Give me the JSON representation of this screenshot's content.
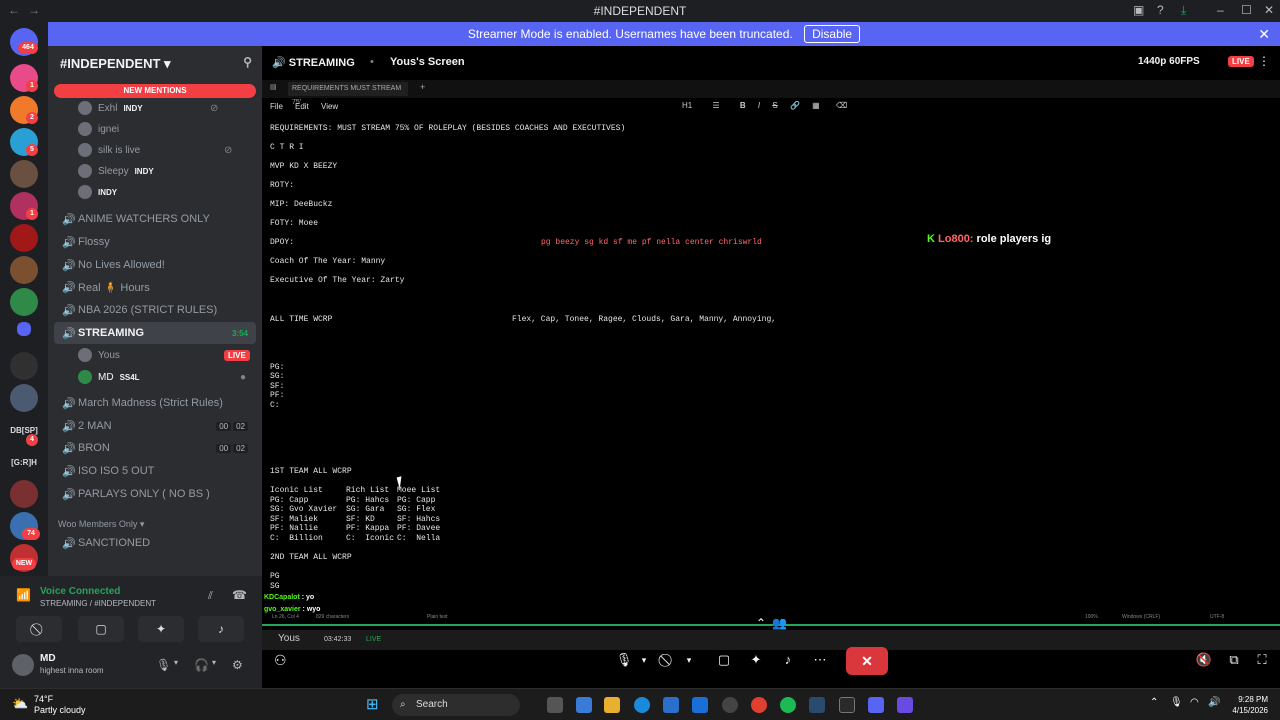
{
  "window": {
    "title": "#INDEPENDENT"
  },
  "banner": {
    "text": "Streamer Mode is enabled. Usernames have been truncated.",
    "disable_label": "Disable"
  },
  "servers": {
    "dm_badge": "464",
    "badges": [
      "1",
      "2",
      "5",
      "1",
      "1",
      "4",
      "74"
    ],
    "text_labels": [
      "DB[SP]",
      "[G:R]H"
    ],
    "new_label": "NEW"
  },
  "server": {
    "name": "#INDEPENDENT",
    "new_mentions": "NEW MENTIONS"
  },
  "voice_users_top": [
    {
      "name": "Exhl",
      "tag": "INDY"
    },
    {
      "name": "ignei",
      "tag": ""
    },
    {
      "name": "silk is live",
      "tag": ""
    },
    {
      "name": "Sleepy",
      "tag": "INDY"
    },
    {
      "name": "",
      "tag": "INDY"
    }
  ],
  "channels": [
    {
      "name": "ANIME WATCHERS ONLY"
    },
    {
      "name": "Flossy"
    },
    {
      "name": "No Lives Allowed!"
    },
    {
      "name": "Real 🧍 Hours"
    },
    {
      "name": "NBA 2026 (STRICT RULES)"
    },
    {
      "name": "STREAMING",
      "time": "3:54"
    }
  ],
  "streaming_users": [
    {
      "name": "Yous",
      "live": "LIVE"
    },
    {
      "name": "MD",
      "tag": "SS4L"
    }
  ],
  "channels2": [
    {
      "name": "March Madness (Strict Rules)"
    },
    {
      "name": "2 MAN",
      "c1": "00",
      "c2": "02"
    },
    {
      "name": "BRON",
      "c1": "00",
      "c2": "02"
    },
    {
      "name": "ISO ISO 5 OUT"
    },
    {
      "name": "PARLAYS ONLY ( NO BS )"
    }
  ],
  "category": {
    "name": "Woo Members Only"
  },
  "channel_sanctioned": "SANCTIONED",
  "voice": {
    "status": "Voice Connected",
    "location": "STREAMING / #INDEPENDENT"
  },
  "user": {
    "name": "MD",
    "status": "highest inna room"
  },
  "stream": {
    "channel": "STREAMING",
    "screen": "Yous's Screen",
    "quality": "1440p 60FPS",
    "live": "LIVE"
  },
  "notepad": {
    "tab": "REQUIREMENTS MUST STREAM 75'",
    "menu": [
      "File",
      "Edit",
      "View"
    ],
    "toolbar_h": "H1",
    "lines": [
      "REQUIREMENTS: MUST STREAM 75% OF ROLEPLAY (BESIDES COACHES AND EXECUTIVES)",
      "C T R I",
      "MVP KD X BEEZY",
      "ROTY:",
      "MIP: DeeBuckz",
      "FOTY: Moee",
      "DPOY:",
      "Coach Of The Year: Manny",
      "Executive Of The Year: Zarty",
      "ALL TIME WCRP",
      "PG:",
      "SG:",
      "SF:",
      "PF:",
      "C:",
      "1ST TEAM ALL WCRP",
      "Iconic List",
      "PG: Capp",
      "SG: Gvo Xavier",
      "SF: Maliek",
      "PF: Nallie",
      "C:  Billion",
      "2ND TEAM ALL WCRP",
      "PG",
      "SG"
    ],
    "col2": [
      "Rich List",
      "PG: Hahcs",
      "SG: Gara",
      "SF: KD",
      "PF: Kappa",
      "C:  Iconic"
    ],
    "col3": [
      "Moee List",
      "PG: Capp",
      "SG: Flex",
      "SF: Hahcs",
      "PF: Davee",
      "C:  Nella"
    ],
    "dpoy_note": "pg beezy sg kd sf me pf nella center chriswrld",
    "wcrp_names": "Flex, Cap, Tonee, Ragee, Clouds, Gara, Manny, Annoying,",
    "status": [
      "Ln 26, Col 4",
      "829 characters",
      "Plain text",
      "100%",
      "Windows (CRLF)",
      "UTF-8"
    ]
  },
  "overlay": {
    "user": "Lo800:",
    "msg": "role players ig"
  },
  "chat": [
    {
      "user": "KDCapalot",
      "msg": "yo"
    },
    {
      "user": "gvo_xavier",
      "msg": "wyo"
    }
  ],
  "mini": {
    "user": "Yous",
    "time": "03:42:33",
    "live": "LIVE"
  },
  "taskbar": {
    "temp": "74°F",
    "cond": "Partly cloudy",
    "search": "Search",
    "time": "9:28 PM",
    "date": "4/15/2026"
  }
}
